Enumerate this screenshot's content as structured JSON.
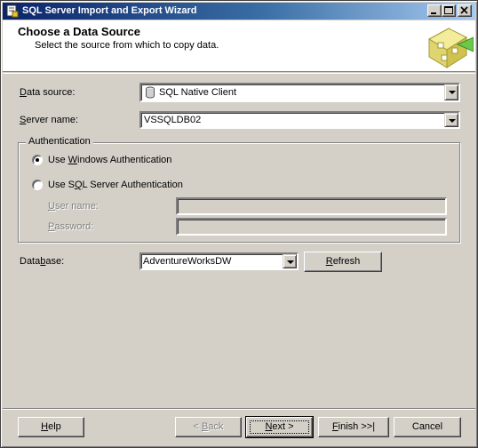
{
  "window": {
    "title": "SQL Server Import and Export Wizard",
    "minimize_icon": "minimize-icon",
    "maximize_icon": "maximize-icon",
    "close_icon": "close-icon"
  },
  "header": {
    "title": "Choose a Data Source",
    "subtitle": "Select the source from which to copy data."
  },
  "form": {
    "data_source": {
      "label_accel": "D",
      "label_rest": "ata source:",
      "value": "SQL Native Client",
      "icon": "database-cylinder-icon"
    },
    "server_name": {
      "label_accel": "S",
      "label_rest": "erver name:",
      "value": "VSSQLDB02"
    },
    "authentication": {
      "legend": "Authentication",
      "windows": {
        "pre": "Use ",
        "accel": "W",
        "post": "indows Authentication",
        "checked": true
      },
      "sql": {
        "pre": "Use S",
        "accel": "Q",
        "post": "L Server Authentication",
        "checked": false
      },
      "user_name": {
        "accel": "U",
        "rest": "ser name:",
        "value": ""
      },
      "password": {
        "accel": "P",
        "rest": "assword:",
        "value": ""
      }
    },
    "database": {
      "pre": "Data",
      "accel": "b",
      "post": "ase:",
      "value": "AdventureWorksDW"
    },
    "refresh": {
      "accel": "R",
      "rest": "efresh"
    }
  },
  "footer": {
    "help": {
      "accel": "H",
      "rest": "elp"
    },
    "back": {
      "pre": "< ",
      "accel": "B",
      "rest": "ack"
    },
    "next": {
      "accel": "N",
      "rest": "ext >"
    },
    "finish": {
      "accel": "F",
      "rest": "inish >>|"
    },
    "cancel": "Cancel"
  },
  "colors": {
    "titlebar_start": "#0a246a",
    "titlebar_end": "#a6caf0",
    "face": "#d4d0c8"
  }
}
